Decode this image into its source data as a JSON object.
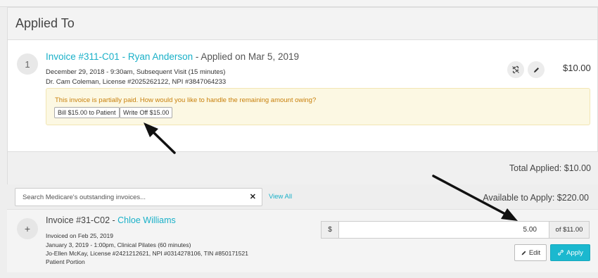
{
  "panel": {
    "title": "Applied To"
  },
  "applied_invoice": {
    "index": "1",
    "invoice_link": "Invoice #311-C01 - Ryan Anderson",
    "applied_suffix": " - Applied on Mar 5, 2019",
    "visit_line": "December 29, 2018 - 9:30am, Subsequent Visit (15 minutes)",
    "provider_line": "Dr. Cam Coleman, License #2025262122, NPI #3847064233",
    "amount": "$10.00",
    "unlink_icon": "unlink-icon",
    "edit_icon": "pencil-icon"
  },
  "partial_notice": {
    "message": "This invoice is partially paid. How would you like to handle the remaining amount owing?",
    "bill_button": "Bill $15.00 to Patient",
    "writeoff_button": "Write Off $15.00"
  },
  "totals": {
    "total_applied": "Total Applied: $10.00",
    "available": "Available to Apply: $220.00"
  },
  "search": {
    "placeholder": "Search Medicare's outstanding invoices...",
    "clear_icon": "close-icon",
    "view_all": "View All"
  },
  "outstanding_invoice": {
    "expand_symbol": "+",
    "number": "Invoice #31-C02 - ",
    "patient": "Chloe Williams",
    "invoiced_on": "Invoiced on Feb 25, 2019",
    "visit_line": "January 3, 2019 - 1:00pm, Clinical Pilates (60 minutes)",
    "provider_line": "Jo-Ellen McKay, License #2421212621, NPI #0314278106, TIN #850171521",
    "portion": "Patient Portion",
    "currency": "$",
    "amount_value": "5.00",
    "of_total": "of $11.00",
    "edit_label": "Edit",
    "apply_label": "Apply"
  },
  "colors": {
    "accent": "#19b0c8",
    "warning_bg": "#fcf8e3",
    "warning_text": "#c87f0a"
  }
}
